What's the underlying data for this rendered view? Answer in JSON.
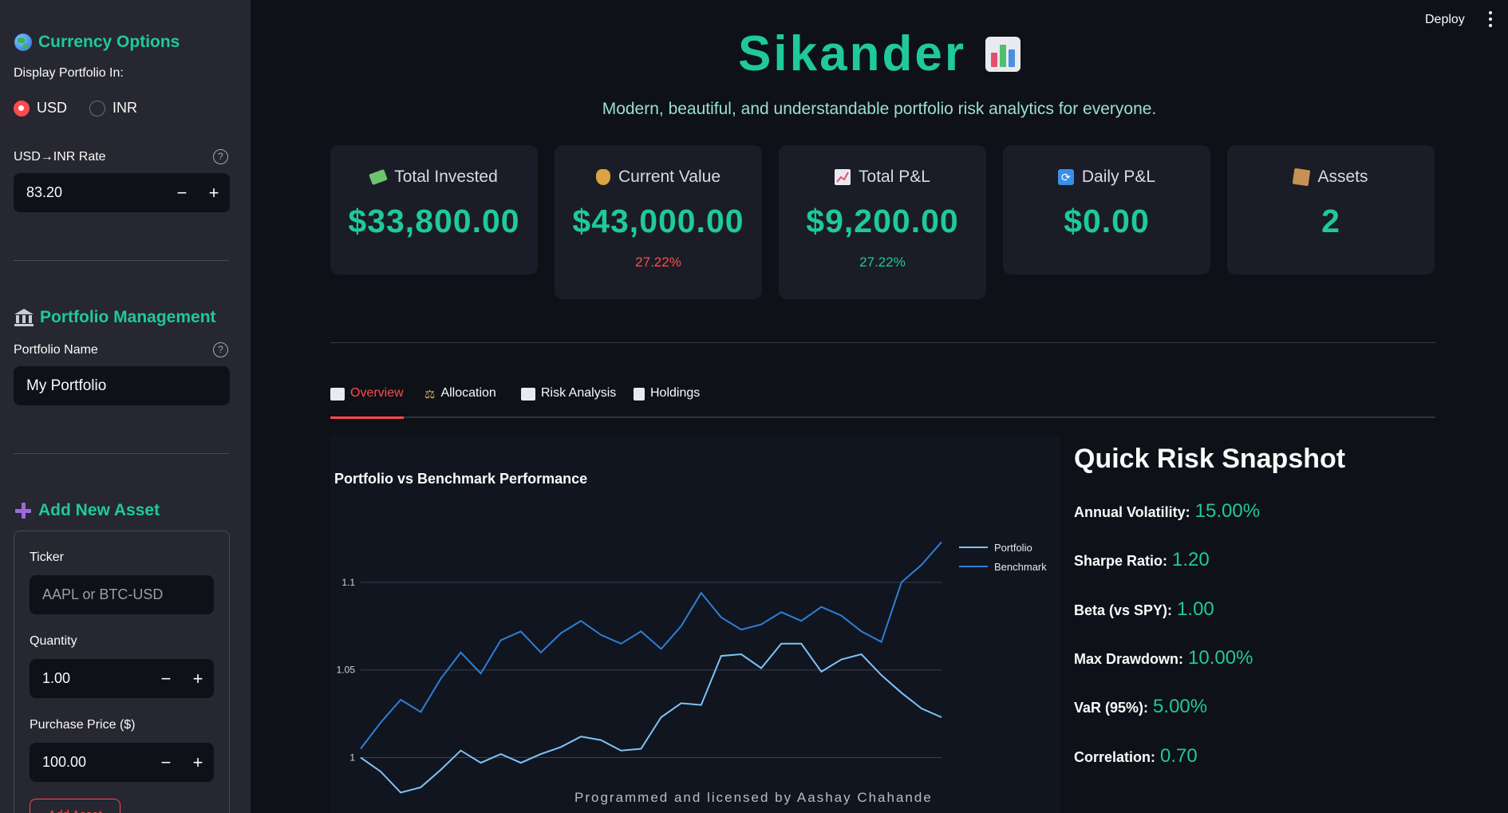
{
  "sidebar": {
    "currency": {
      "title": "Currency Options",
      "display_label": "Display Portfolio In:",
      "options": [
        "USD",
        "INR"
      ],
      "selected": "USD",
      "rate_label": "USD→INR Rate",
      "rate_value": "83.20"
    },
    "portfolio": {
      "title": "Portfolio Management",
      "name_label": "Portfolio Name",
      "name_value": "My Portfolio"
    },
    "add_asset": {
      "title": "Add New Asset",
      "ticker_label": "Ticker",
      "ticker_placeholder": "AAPL or BTC-USD",
      "quantity_label": "Quantity",
      "quantity_value": "1.00",
      "price_label": "Purchase Price ($)",
      "price_value": "100.00",
      "submit_label": "Add Asset"
    }
  },
  "topbar": {
    "deploy_label": "Deploy"
  },
  "hero": {
    "title": "Sikander",
    "subtitle": "Modern, beautiful, and understandable portfolio risk analytics for everyone."
  },
  "metrics": [
    {
      "label": "Total Invested",
      "value": "$33,800.00",
      "delta": ""
    },
    {
      "label": "Current Value",
      "value": "$43,000.00",
      "delta": "27.22%",
      "delta_color": "#ff4b4b"
    },
    {
      "label": "Total P&L",
      "value": "$9,200.00",
      "delta": "27.22%",
      "delta_color": "#1fc99b"
    },
    {
      "label": "Daily P&L",
      "value": "$0.00",
      "delta": ""
    },
    {
      "label": "Assets",
      "value": "2",
      "delta": ""
    }
  ],
  "tabs": [
    {
      "label": "Overview",
      "active": true
    },
    {
      "label": "Allocation",
      "active": false
    },
    {
      "label": "Risk Analysis",
      "active": false
    },
    {
      "label": "Holdings",
      "active": false
    }
  ],
  "chart_data": {
    "type": "line",
    "title": "Portfolio vs Benchmark Performance",
    "xlabel": "",
    "ylabel": "",
    "ylim": [
      0.972,
      1.12
    ],
    "yticks": [
      1,
      1.05,
      1.1
    ],
    "ytick_labels": [
      "1",
      "1.05",
      "1.1"
    ],
    "grid": true,
    "legend_position": "top-right",
    "series": [
      {
        "name": "Portfolio",
        "color": "#7ec3f7",
        "values": [
          1.0,
          0.992,
          0.98,
          0.983,
          0.993,
          1.004,
          0.997,
          1.002,
          0.997,
          1.002,
          1.006,
          1.012,
          1.01,
          1.004,
          1.005,
          1.023,
          1.031,
          1.03,
          1.058,
          1.059,
          1.051,
          1.065,
          1.065,
          1.049,
          1.056,
          1.059,
          1.047,
          1.037,
          1.028,
          1.023
        ]
      },
      {
        "name": "Benchmark",
        "color": "#2e7fd6",
        "values": [
          1.005,
          1.02,
          1.033,
          1.026,
          1.045,
          1.06,
          1.048,
          1.067,
          1.072,
          1.06,
          1.071,
          1.078,
          1.07,
          1.065,
          1.072,
          1.062,
          1.075,
          1.094,
          1.08,
          1.073,
          1.076,
          1.083,
          1.078,
          1.086,
          1.081,
          1.072,
          1.066,
          1.1,
          1.11,
          1.123
        ]
      }
    ]
  },
  "credit": "Programmed and licensed by Aashay Chahande",
  "snapshot": {
    "title": "Quick Risk Snapshot",
    "items": [
      {
        "label": "Annual Volatility:",
        "value": "15.00%"
      },
      {
        "label": "Sharpe Ratio:",
        "value": "1.20"
      },
      {
        "label": "Beta (vs SPY):",
        "value": "1.00"
      },
      {
        "label": "Max Drawdown:",
        "value": "10.00%"
      },
      {
        "label": "VaR (95%):",
        "value": "5.00%"
      },
      {
        "label": "Correlation:",
        "value": "0.70"
      }
    ]
  },
  "colors": {
    "accent": "#1fc99b",
    "danger": "#ff4b4b",
    "background": "#0e1117",
    "sidebar": "#262730"
  }
}
